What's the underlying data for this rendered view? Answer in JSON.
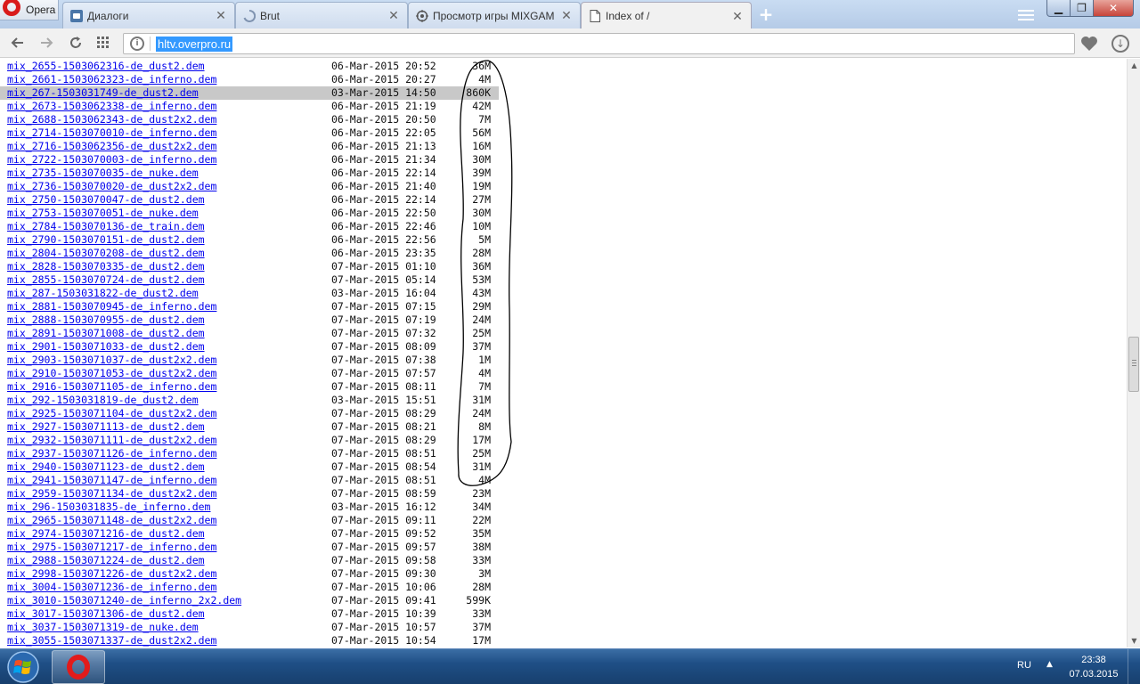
{
  "opera_menu": {
    "label": "Opera"
  },
  "tabs": [
    {
      "title": "Диалоги",
      "active": false,
      "favicon": "vk-icon"
    },
    {
      "title": "Brut",
      "active": false,
      "favicon": "loading-icon"
    },
    {
      "title": "Просмотр игры MIXGAM",
      "active": false,
      "favicon": "gear-icon"
    },
    {
      "title": "Index of /",
      "active": true,
      "favicon": "document-icon"
    }
  ],
  "tab_close_glyph": "✕",
  "address_bar": {
    "url": "hltv.overpro.ru"
  },
  "listing": {
    "highlighted_index": 2,
    "rows": [
      {
        "name": "mix_2655-1503062316-de_dust2.dem",
        "date": "06-Mar-2015 20:52",
        "size": "36M"
      },
      {
        "name": "mix_2661-1503062323-de_inferno.dem",
        "date": "06-Mar-2015 20:27",
        "size": "4M"
      },
      {
        "name": "mix_267-1503031749-de_dust2.dem",
        "date": "03-Mar-2015 14:50",
        "size": "860K"
      },
      {
        "name": "mix_2673-1503062338-de_inferno.dem",
        "date": "06-Mar-2015 21:19",
        "size": "42M"
      },
      {
        "name": "mix_2688-1503062343-de_dust2x2.dem",
        "date": "06-Mar-2015 20:50",
        "size": "7M"
      },
      {
        "name": "mix_2714-1503070010-de_inferno.dem",
        "date": "06-Mar-2015 22:05",
        "size": "56M"
      },
      {
        "name": "mix_2716-1503062356-de_dust2x2.dem",
        "date": "06-Mar-2015 21:13",
        "size": "16M"
      },
      {
        "name": "mix_2722-1503070003-de_inferno.dem",
        "date": "06-Mar-2015 21:34",
        "size": "30M"
      },
      {
        "name": "mix_2735-1503070035-de_nuke.dem",
        "date": "06-Mar-2015 22:14",
        "size": "39M"
      },
      {
        "name": "mix_2736-1503070020-de_dust2x2.dem",
        "date": "06-Mar-2015 21:40",
        "size": "19M"
      },
      {
        "name": "mix_2750-1503070047-de_dust2.dem",
        "date": "06-Mar-2015 22:14",
        "size": "27M"
      },
      {
        "name": "mix_2753-1503070051-de_nuke.dem",
        "date": "06-Mar-2015 22:50",
        "size": "30M"
      },
      {
        "name": "mix_2784-1503070136-de_train.dem",
        "date": "06-Mar-2015 22:46",
        "size": "10M"
      },
      {
        "name": "mix_2790-1503070151-de_dust2.dem",
        "date": "06-Mar-2015 22:56",
        "size": "5M"
      },
      {
        "name": "mix_2804-1503070208-de_dust2.dem",
        "date": "06-Mar-2015 23:35",
        "size": "28M"
      },
      {
        "name": "mix_2828-1503070335-de_dust2.dem",
        "date": "07-Mar-2015 01:10",
        "size": "36M"
      },
      {
        "name": "mix_2855-1503070724-de_dust2.dem",
        "date": "07-Mar-2015 05:14",
        "size": "53M"
      },
      {
        "name": "mix_287-1503031822-de_dust2.dem",
        "date": "03-Mar-2015 16:04",
        "size": "43M"
      },
      {
        "name": "mix_2881-1503070945-de_inferno.dem",
        "date": "07-Mar-2015 07:15",
        "size": "29M"
      },
      {
        "name": "mix_2888-1503070955-de_dust2.dem",
        "date": "07-Mar-2015 07:19",
        "size": "24M"
      },
      {
        "name": "mix_2891-1503071008-de_dust2.dem",
        "date": "07-Mar-2015 07:32",
        "size": "25M"
      },
      {
        "name": "mix_2901-1503071033-de_dust2.dem",
        "date": "07-Mar-2015 08:09",
        "size": "37M"
      },
      {
        "name": "mix_2903-1503071037-de_dust2x2.dem",
        "date": "07-Mar-2015 07:38",
        "size": "1M"
      },
      {
        "name": "mix_2910-1503071053-de_dust2x2.dem",
        "date": "07-Mar-2015 07:57",
        "size": "4M"
      },
      {
        "name": "mix_2916-1503071105-de_inferno.dem",
        "date": "07-Mar-2015 08:11",
        "size": "7M"
      },
      {
        "name": "mix_292-1503031819-de_dust2.dem",
        "date": "03-Mar-2015 15:51",
        "size": "31M"
      },
      {
        "name": "mix_2925-1503071104-de_dust2x2.dem",
        "date": "07-Mar-2015 08:29",
        "size": "24M"
      },
      {
        "name": "mix_2927-1503071113-de_dust2.dem",
        "date": "07-Mar-2015 08:21",
        "size": "8M"
      },
      {
        "name": "mix_2932-1503071111-de_dust2x2.dem",
        "date": "07-Mar-2015 08:29",
        "size": "17M"
      },
      {
        "name": "mix_2937-1503071126-de_inferno.dem",
        "date": "07-Mar-2015 08:51",
        "size": "25M"
      },
      {
        "name": "mix_2940-1503071123-de_dust2.dem",
        "date": "07-Mar-2015 08:54",
        "size": "31M"
      },
      {
        "name": "mix_2941-1503071147-de_inferno.dem",
        "date": "07-Mar-2015 08:51",
        "size": "4M"
      },
      {
        "name": "mix_2959-1503071134-de_dust2x2.dem",
        "date": "07-Mar-2015 08:59",
        "size": "23M"
      },
      {
        "name": "mix_296-1503031835-de_inferno.dem",
        "date": "03-Mar-2015 16:12",
        "size": "34M"
      },
      {
        "name": "mix_2965-1503071148-de_dust2x2.dem",
        "date": "07-Mar-2015 09:11",
        "size": "22M"
      },
      {
        "name": "mix_2974-1503071216-de_dust2.dem",
        "date": "07-Mar-2015 09:52",
        "size": "35M"
      },
      {
        "name": "mix_2975-1503071217-de_inferno.dem",
        "date": "07-Mar-2015 09:57",
        "size": "38M"
      },
      {
        "name": "mix_2988-1503071224-de_dust2.dem",
        "date": "07-Mar-2015 09:58",
        "size": "33M"
      },
      {
        "name": "mix_2998-1503071226-de_dust2x2.dem",
        "date": "07-Mar-2015 09:30",
        "size": "3M"
      },
      {
        "name": "mix_3004-1503071236-de_inferno.dem",
        "date": "07-Mar-2015 10:06",
        "size": "28M"
      },
      {
        "name": "mix_3010-1503071240-de_inferno_2x2.dem",
        "date": "07-Mar-2015 09:41",
        "size": "599K"
      },
      {
        "name": "mix_3017-1503071306-de_dust2.dem",
        "date": "07-Mar-2015 10:39",
        "size": "33M"
      },
      {
        "name": "mix_3037-1503071319-de_nuke.dem",
        "date": "07-Mar-2015 10:57",
        "size": "37M"
      },
      {
        "name": "mix_3055-1503071337-de_dust2x2.dem",
        "date": "07-Mar-2015 10:54",
        "size": "17M"
      }
    ]
  },
  "taskbar": {
    "language": "RU",
    "time": "23:38",
    "date": "07.03.2015"
  },
  "colors": {
    "link": "#0000ee",
    "highlight_row": "#c8c8c8",
    "url_selection": "#3399ff",
    "opera_red": "#d91b1b",
    "taskbar": "#1f4f86"
  }
}
